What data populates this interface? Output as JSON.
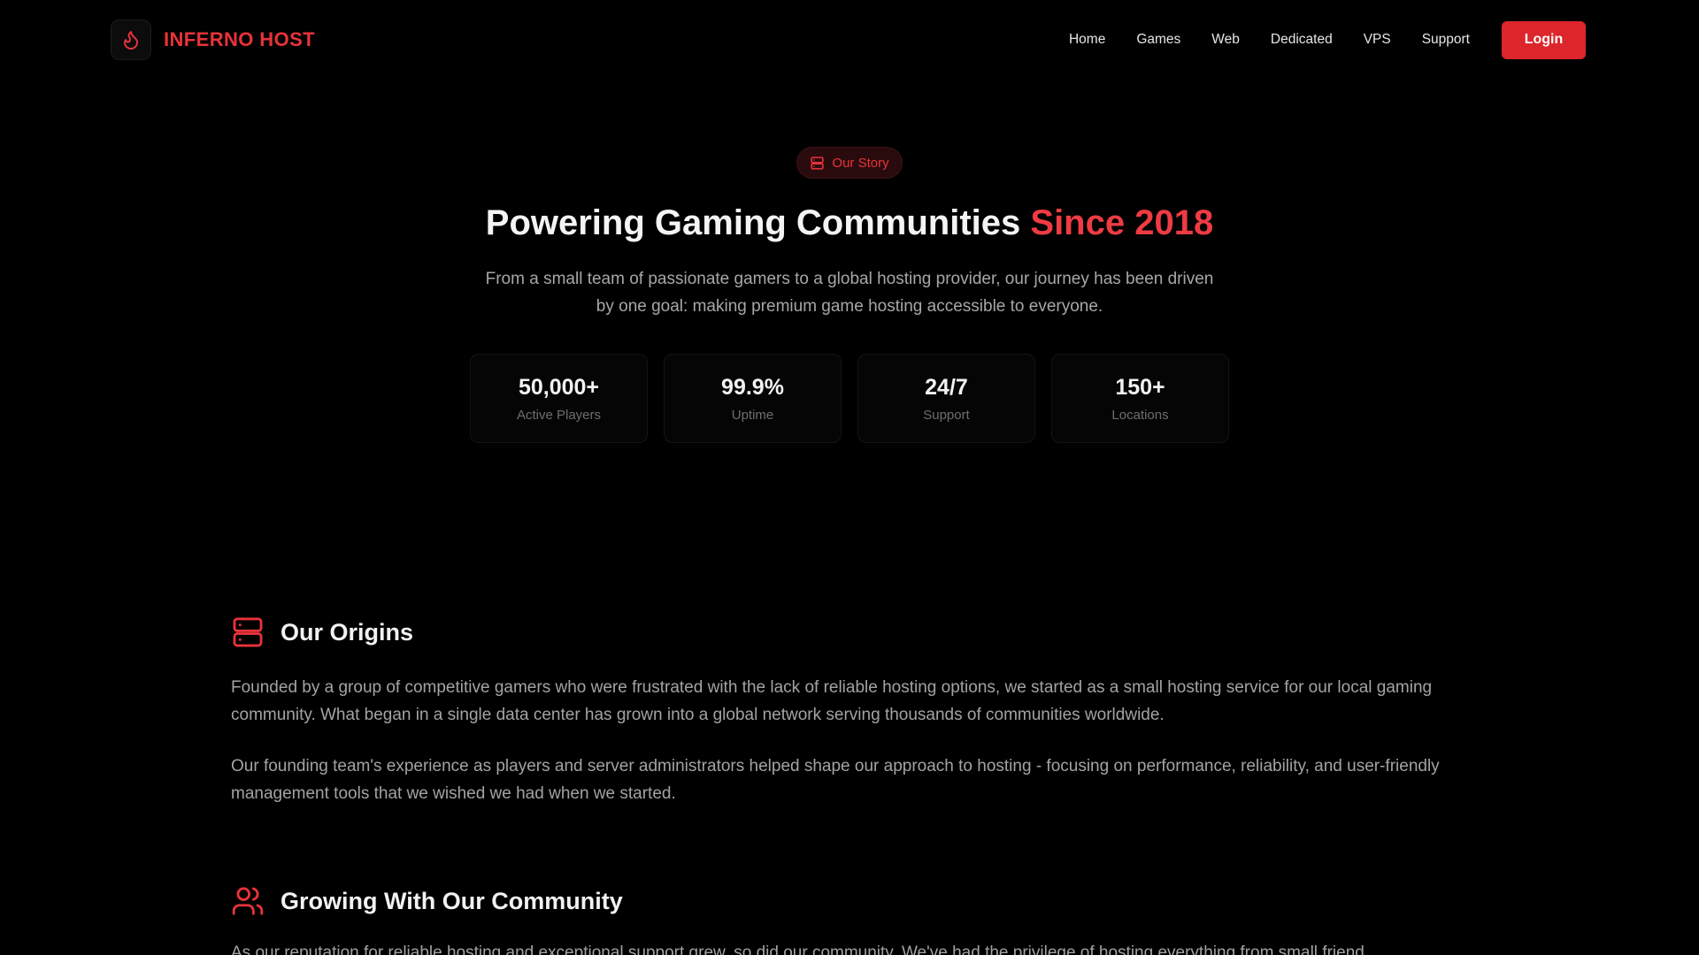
{
  "brand": {
    "name": "INFERNO HOST",
    "icon": "flame-icon",
    "accent_color": "#e8333a"
  },
  "nav": {
    "links": [
      "Home",
      "Games",
      "Web",
      "Dedicated",
      "VPS",
      "Support"
    ],
    "login_label": "Login"
  },
  "hero": {
    "badge_icon": "server-icon",
    "badge_label": "Our Story",
    "title_main": "Powering Gaming Communities ",
    "title_accent": "Since 2018",
    "subtitle": "From a small team of passionate gamers to a global hosting provider, our journey has been driven by one goal: making premium game hosting accessible to everyone."
  },
  "stats": [
    {
      "value": "50,000+",
      "label": "Active Players"
    },
    {
      "value": "99.9%",
      "label": "Uptime"
    },
    {
      "value": "24/7",
      "label": "Support"
    },
    {
      "value": "150+",
      "label": "Locations"
    }
  ],
  "sections": {
    "origins": {
      "icon": "server-icon",
      "title": "Our Origins",
      "paragraphs": [
        "Founded by a group of competitive gamers who were frustrated with the lack of reliable hosting options, we started as a small hosting service for our local gaming community. What began in a single data center has grown into a global network serving thousands of communities worldwide.",
        "Our founding team's experience as players and server administrators helped shape our approach to hosting - focusing on performance, reliability, and user-friendly management tools that we wished we had when we started."
      ]
    },
    "community": {
      "icon": "users-icon",
      "title": "Growing With Our Community",
      "paragraph": "As our reputation for reliable hosting and exceptional support grew, so did our community. We've had the privilege of hosting everything from small friend"
    }
  }
}
